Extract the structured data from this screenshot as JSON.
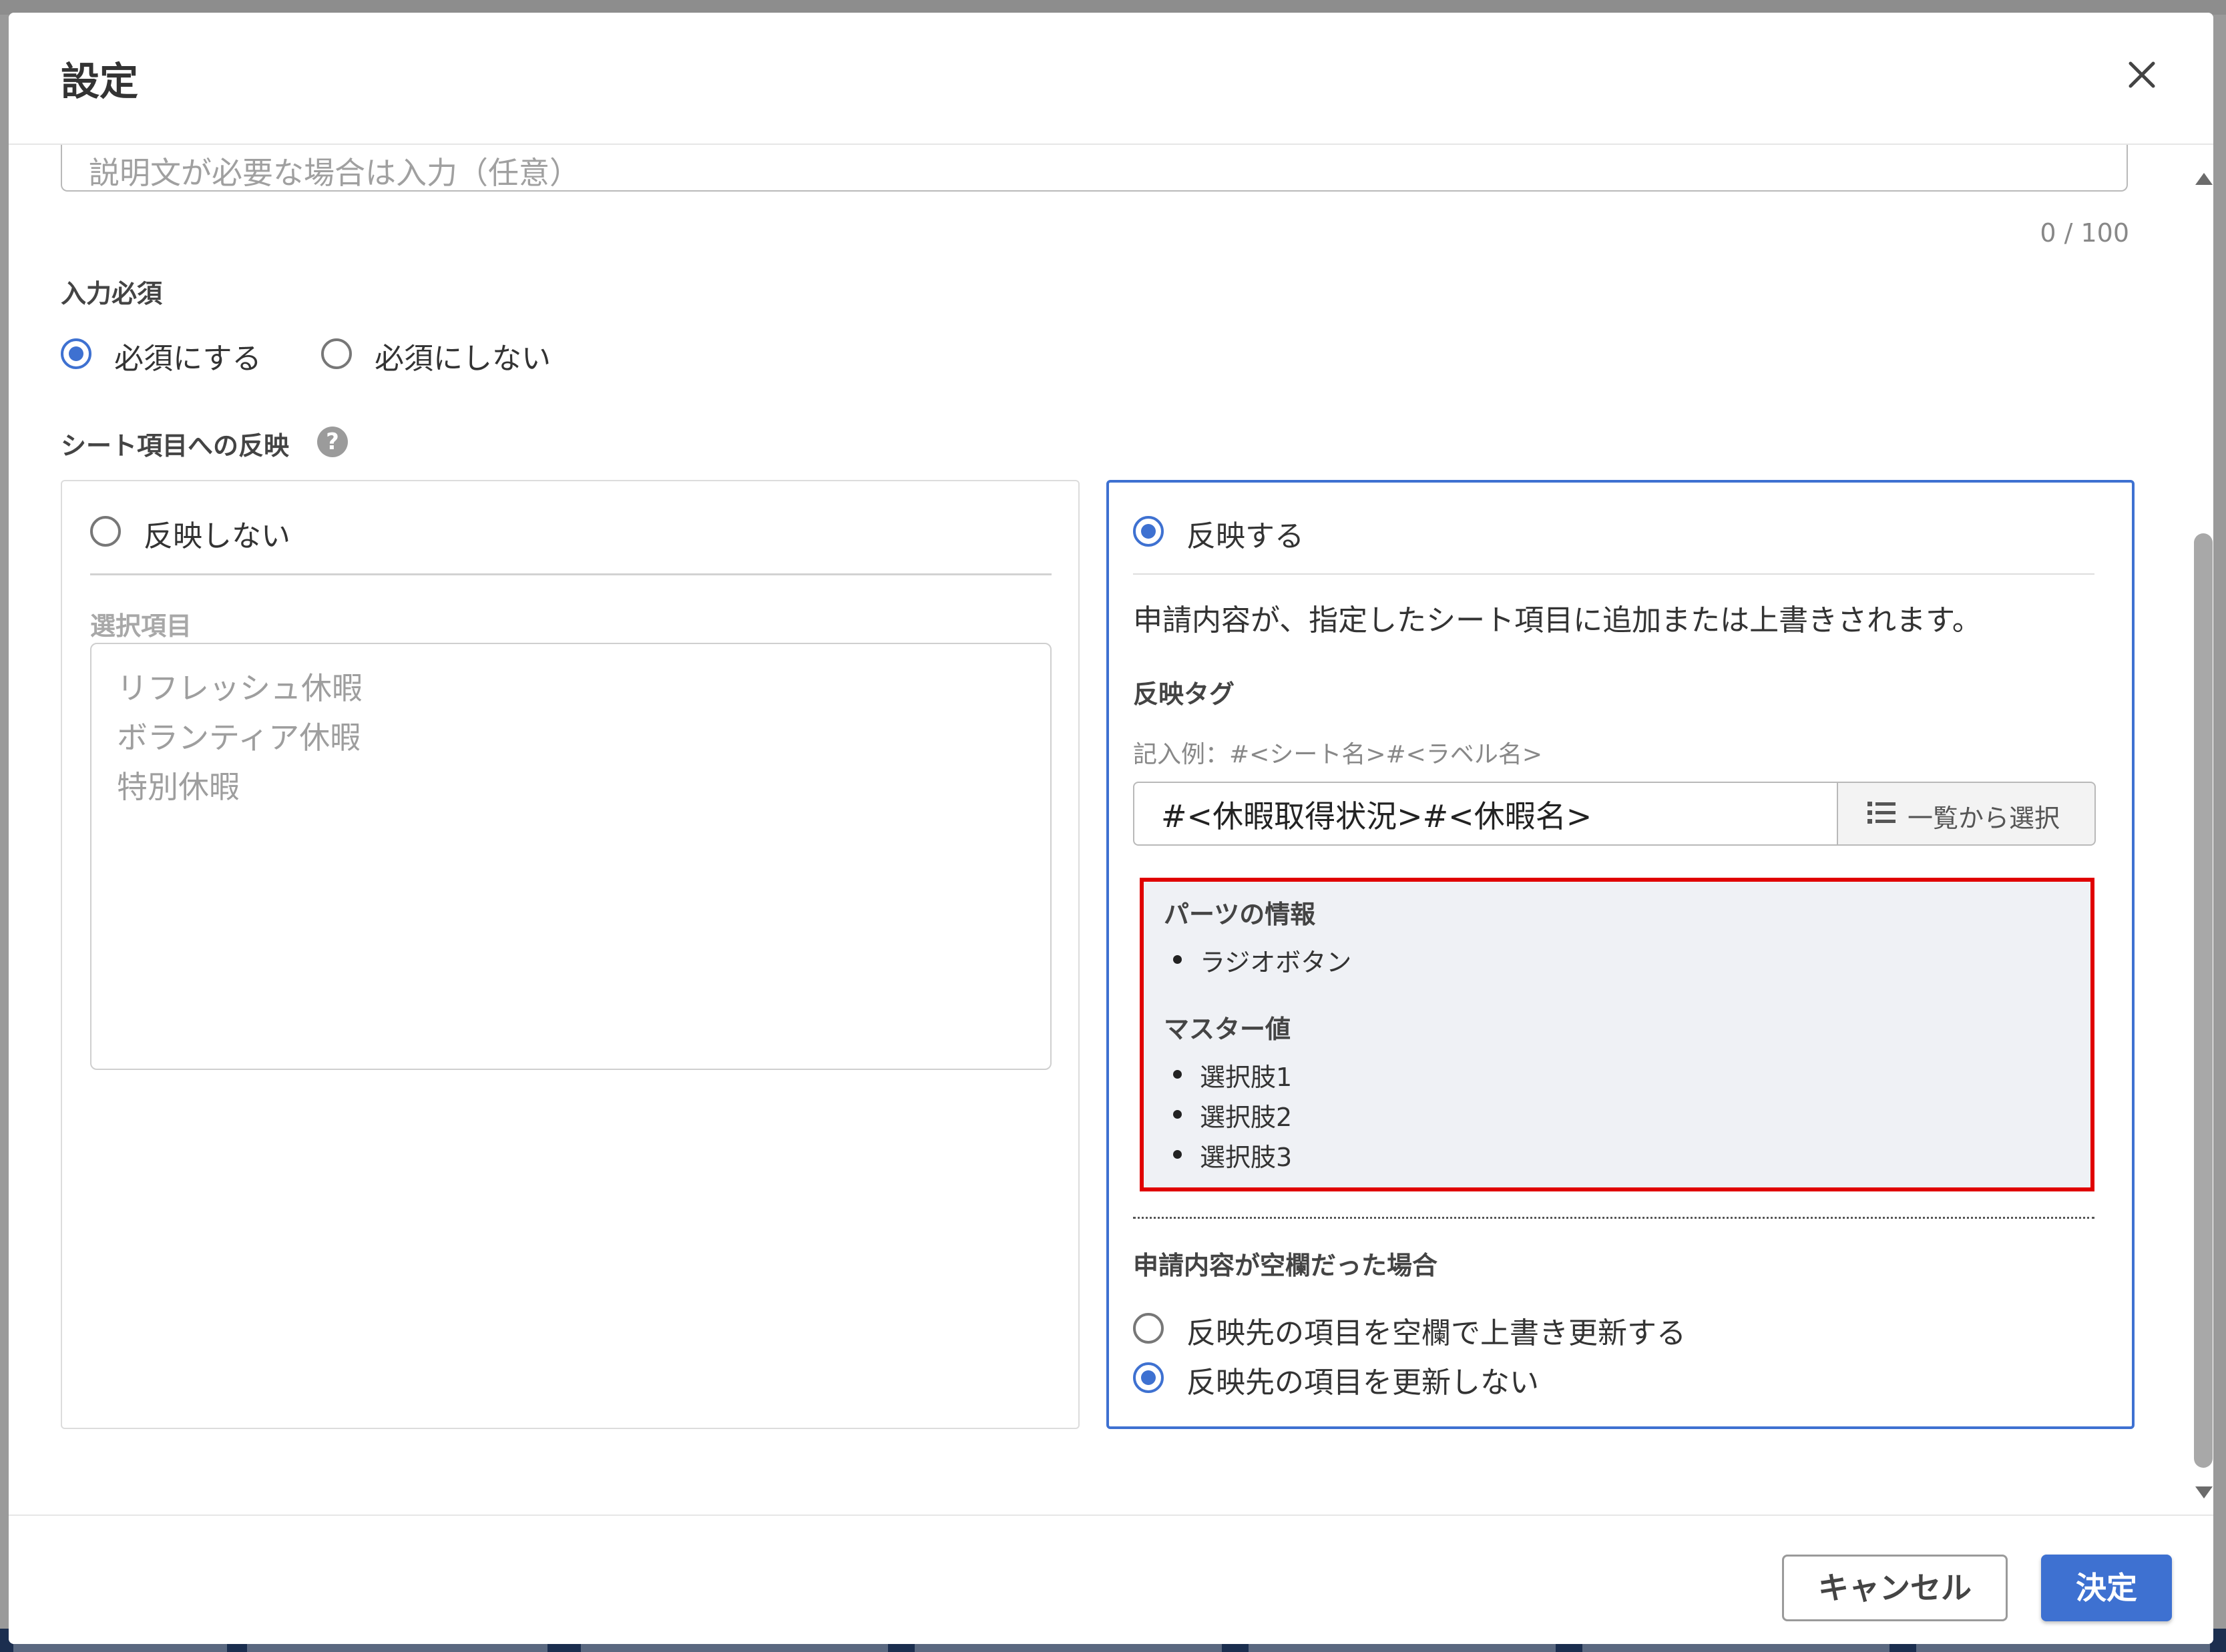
{
  "dialog": {
    "title": "設定",
    "close_icon": "close-icon"
  },
  "description_field": {
    "placeholder": "説明文が必要な場合は入力（任意）",
    "counter": "0 / 100"
  },
  "required": {
    "label": "入力必須",
    "options": [
      {
        "label": "必須にする",
        "checked": true
      },
      {
        "label": "必須にしない",
        "checked": false
      }
    ]
  },
  "reflection": {
    "label": "シート項目への反映",
    "help_icon": "question-icon",
    "help_glyph": "?",
    "left_panel": {
      "option_label": "反映しない",
      "checked": false,
      "choices_label": "選択項目",
      "choices": [
        "リフレッシュ休暇",
        "ボランティア休暇",
        "特別休暇"
      ]
    },
    "right_panel": {
      "option_label": "反映する",
      "checked": true,
      "description": "申請内容が、指定したシート項目に追加または上書きされます。",
      "tag_label": "反映タグ",
      "tag_example": "記入例：#<シート名>#<ラベル名>",
      "tag_value": "#<休暇取得状況>#<休暇名>",
      "list_button": "一覧から選択",
      "list_icon": "list-icon",
      "parts_info": {
        "title": "パーツの情報",
        "items": [
          "ラジオボタン"
        ],
        "master_title": "マスター値",
        "master_items": [
          "選択肢1",
          "選択肢2",
          "選択肢3"
        ]
      },
      "empty_case": {
        "label": "申請内容が空欄だった場合",
        "options": [
          {
            "label": "反映先の項目を空欄で上書き更新する",
            "checked": false
          },
          {
            "label": "反映先の項目を更新しない",
            "checked": true
          }
        ]
      }
    }
  },
  "footer": {
    "cancel": "キャンセル",
    "ok": "決定"
  },
  "colors": {
    "accent": "#3e71d1",
    "highlight_border": "#e00000",
    "info_bg": "#eff1f5"
  }
}
